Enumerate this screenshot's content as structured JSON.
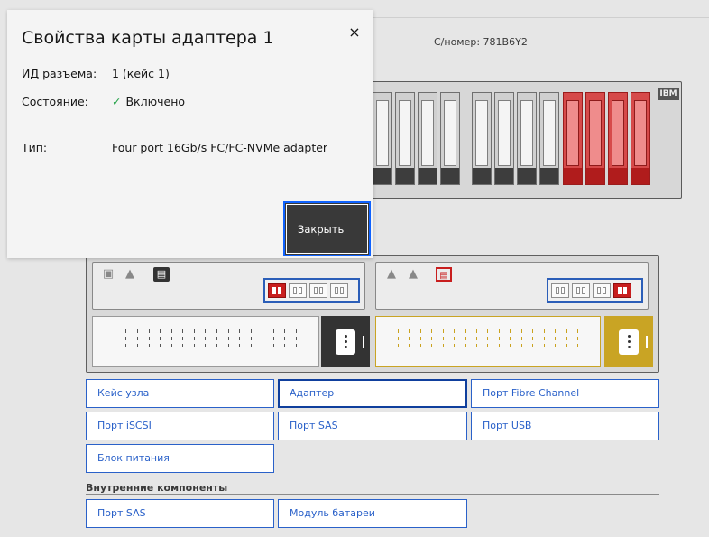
{
  "header": {
    "serial": "С/номер: 781B6Y2"
  },
  "enclosure": {
    "brand": "IBM"
  },
  "components": {
    "buttons": [
      {
        "label": "Кейс узла",
        "selected": false
      },
      {
        "label": "Адаптер",
        "selected": true
      },
      {
        "label": "Порт Fibre Channel",
        "selected": false
      },
      {
        "label": "Порт iSCSI",
        "selected": false
      },
      {
        "label": "Порт SAS",
        "selected": false
      },
      {
        "label": "Порт USB",
        "selected": false
      },
      {
        "label": "Блок питания",
        "selected": false
      }
    ],
    "internal_title": "Внутренние компоненты",
    "internal_buttons": [
      {
        "label": "Порт SAS"
      },
      {
        "label": "Модуль батареи"
      }
    ]
  },
  "modal": {
    "title": "Свойства карты адаптера 1",
    "close_icon": "×",
    "rows": [
      {
        "label": "ИД разъема:",
        "value": "1 (кейс 1)"
      },
      {
        "label": "Состояние:",
        "value": "Включено",
        "icon": "✓"
      },
      {
        "label": "Тип:",
        "value": "Four port 16Gb/s FC/FC-NVMe adapter"
      }
    ],
    "close_button": "Закрыть"
  },
  "colors": {
    "accent": "#2a61c9",
    "fault": "#c81e1e",
    "psu_warning": "#caa21e",
    "ok": "#24a148"
  }
}
